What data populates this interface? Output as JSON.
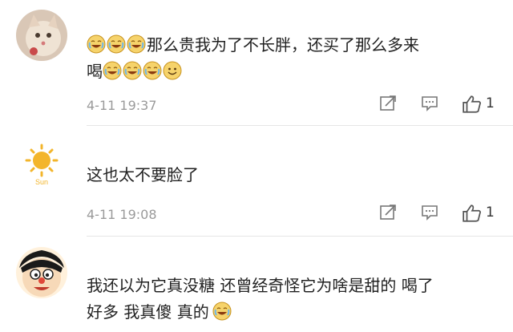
{
  "comments": [
    {
      "avatar": "cat-avatar",
      "text_lead_emoji_count": 3,
      "text_line1": "那么贵我为了不长胖，还买了那么多来",
      "text_line2": "喝",
      "text_trail_emoji": [
        "cry-laugh-emoji",
        "cry-laugh-emoji",
        "cry-laugh-emoji",
        "smile-emoji"
      ],
      "time": "4-11 19:37",
      "likes": "1"
    },
    {
      "avatar": "sun-avatar",
      "avatar_label": "Sun",
      "text_line1": "这也太不要脸了",
      "time": "4-11 19:08",
      "likes": "1"
    },
    {
      "avatar": "cartoon-face-avatar",
      "text_line1": "我还以为它真没糖 还曾经奇怪它为啥是甜的 喝了",
      "text_line2": "好多 我真傻 真的",
      "text_trail_emoji": [
        "cry-laugh-emoji"
      ]
    }
  ],
  "icons": {
    "share": "share-icon",
    "reply": "comment-icon",
    "like": "thumbs-up-icon"
  },
  "colors": {
    "emoji_face": "#f6d36b",
    "emoji_outline": "#c79320",
    "sun": "#f3b52b",
    "time_gray": "#9a9a9a",
    "divider": "#e6e6e6"
  }
}
